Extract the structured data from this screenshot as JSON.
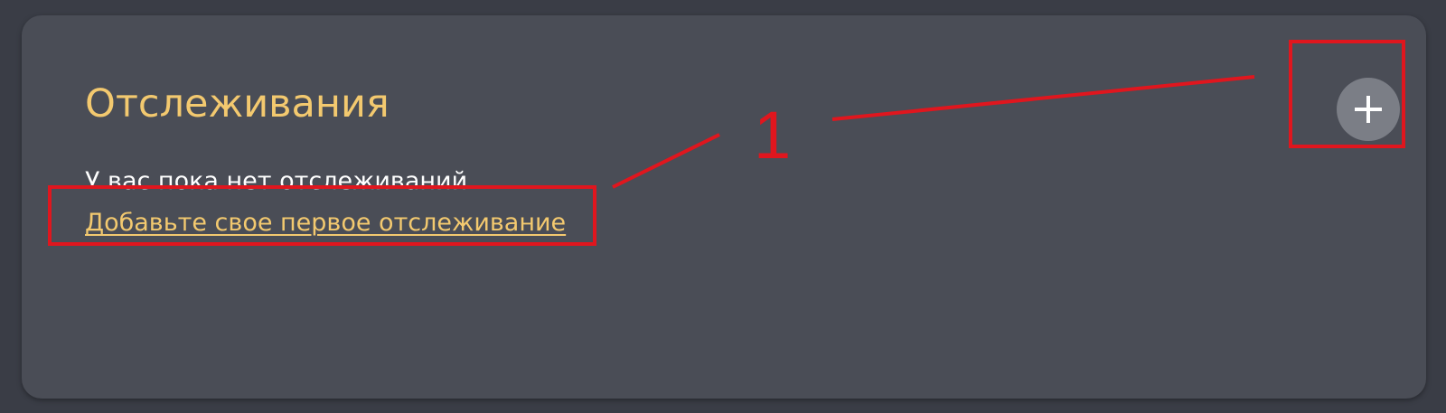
{
  "tracking_panel": {
    "title": "Отслеживания",
    "empty_message": "У вас пока нет отслеживаний.",
    "add_first_link": "Добавьте свое первое отслеживание",
    "add_button_icon": "plus-icon"
  },
  "annotation": {
    "label": "1",
    "color": "#e0161e"
  },
  "colors": {
    "page_background": "#3a3d46",
    "card_background": "#4a4d56",
    "accent": "#f3c96f",
    "button_background": "#7b7e86"
  }
}
